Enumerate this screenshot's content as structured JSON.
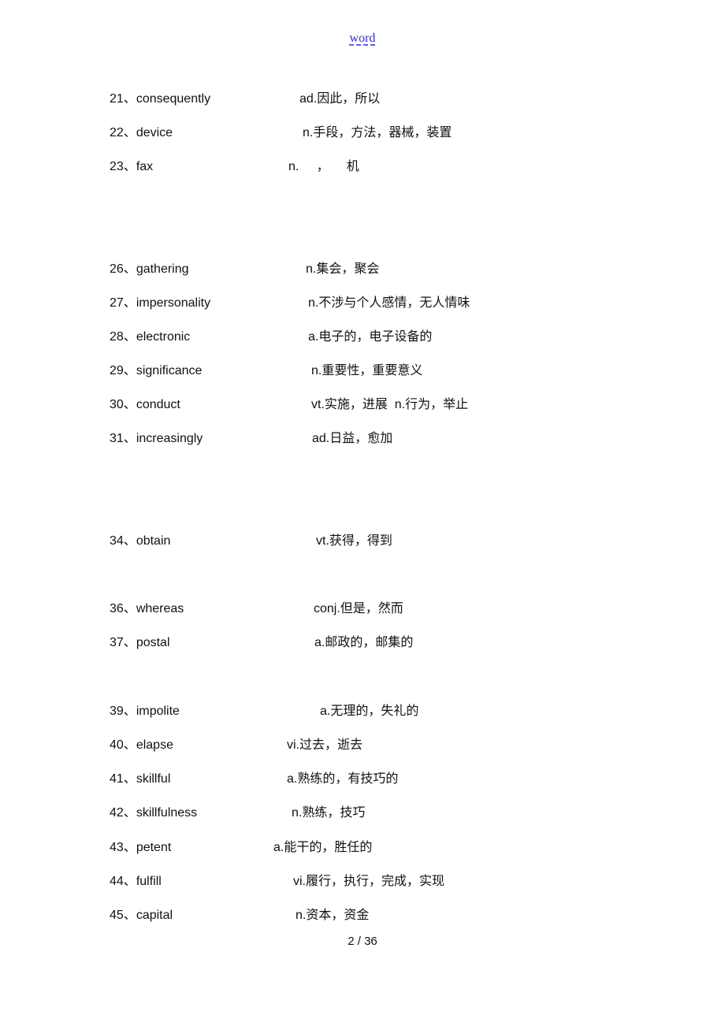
{
  "header": {
    "link_text": "word"
  },
  "entries": [
    {
      "num": "21、",
      "word": "consequently",
      "def": "ad.因此，所以"
    },
    {
      "num": "22、",
      "word": "device",
      "def": "n.手段，方法，器械，装置"
    },
    {
      "num": "23、",
      "word": "fax",
      "def": "n.     ，     机"
    },
    {
      "num": "26、",
      "word": "gathering",
      "def": "n.集会，聚会"
    },
    {
      "num": "27、",
      "word": "impersonality",
      "def": "n.不涉与个人感情，无人情味"
    },
    {
      "num": "28、",
      "word": "electronic",
      "def": "a.电子的，电子设备的"
    },
    {
      "num": "29、",
      "word": "significance",
      "def": "n.重要性，重要意义"
    },
    {
      "num": "30、",
      "word": "conduct",
      "def": "vt.实施，进展  n.行为，举止"
    },
    {
      "num": "31、",
      "word": "increasingly",
      "def": "ad.日益，愈加"
    },
    {
      "num": "34、",
      "word": "obtain",
      "def": "vt.获得，得到"
    },
    {
      "num": "36、",
      "word": "whereas",
      "def": "conj.但是，然而"
    },
    {
      "num": "37、",
      "word": "postal",
      "def": "a.邮政的，邮集的"
    },
    {
      "num": "39、",
      "word": "impolite",
      "def": "a.无理的，失礼的"
    },
    {
      "num": "40、",
      "word": "elapse",
      "def": "vi.过去，逝去"
    },
    {
      "num": "41、",
      "word": "skillful",
      "def": "a.熟练的，有技巧的"
    },
    {
      "num": "42、",
      "word": "skillfulness",
      "def": "n.熟练，技巧"
    },
    {
      "num": "43、",
      "word": "petent",
      "def": "a.能干的，胜任的"
    },
    {
      "num": "44、",
      "word": "fulfill",
      "def": "vi.履行，执行，完成，实现"
    },
    {
      "num": "45、",
      "word": "capital",
      "def": "n.资本，资金"
    }
  ],
  "footer": {
    "page_indicator": "2 / 36"
  }
}
